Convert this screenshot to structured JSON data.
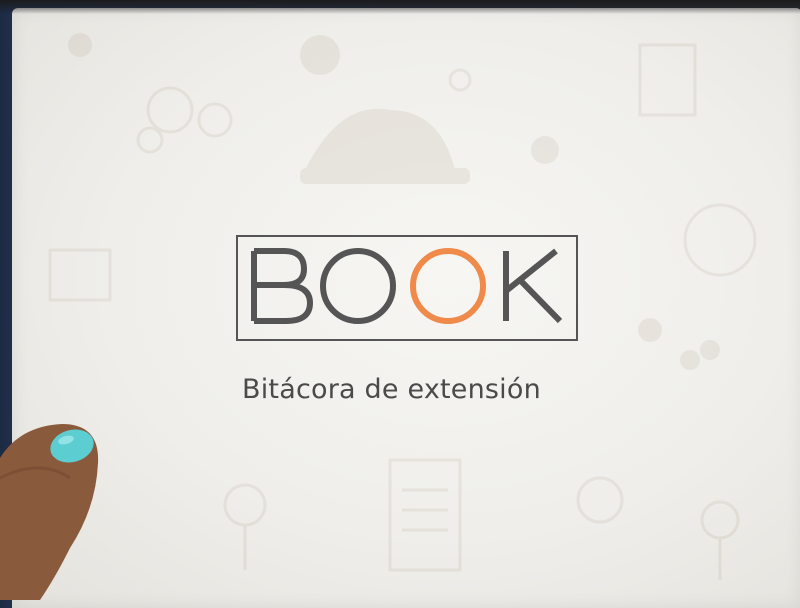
{
  "photo": {
    "subject": "Notebook cover held by a hand",
    "logo": {
      "word": "BOOK",
      "tagline": "Bitácora de extensión"
    },
    "colors": {
      "cover": "#f1f0ec",
      "logo_gray": "#555555",
      "logo_orange": "#f08a4b",
      "nail": "#5ccdd0",
      "skin": "#8a5a3c"
    }
  }
}
